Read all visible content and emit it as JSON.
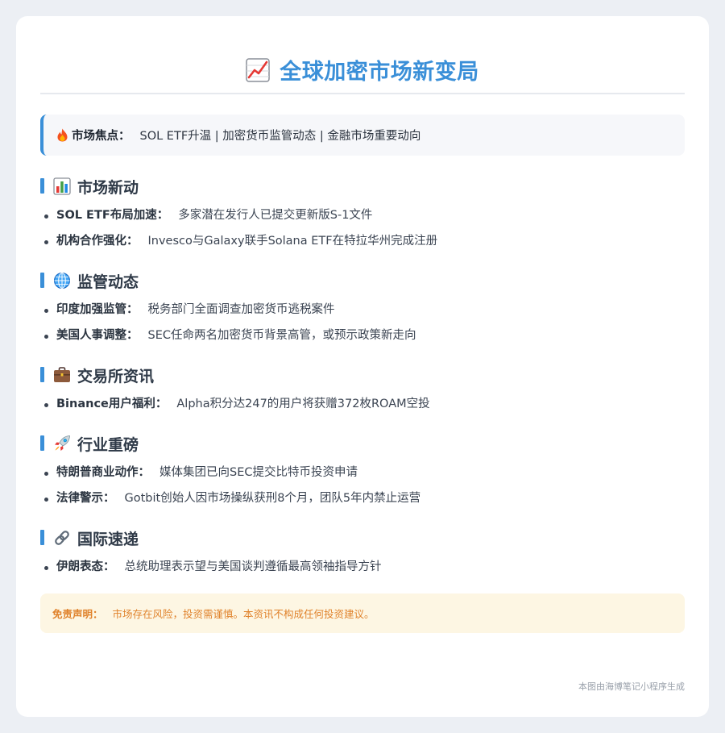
{
  "header": {
    "title": "全球加密市场新变局",
    "title_icon": "chart-increasing-icon"
  },
  "focus": {
    "icon": "fire-icon",
    "label": "市场焦点：",
    "text": "SOL ETF升温 | 加密货币监管动态 | 金融市场重要动向"
  },
  "sections": [
    {
      "title": "市场新动",
      "icon": "bar-chart-icon",
      "items": [
        {
          "label": "SOL ETF布局加速：",
          "text": "多家潜在发行人已提交更新版S-1文件"
        },
        {
          "label": "机构合作强化：",
          "text": "Invesco与Galaxy联手Solana ETF在特拉华州完成注册"
        }
      ]
    },
    {
      "title": "监管动态",
      "icon": "globe-icon",
      "items": [
        {
          "label": "印度加强监管：",
          "text": "税务部门全面调查加密货币逃税案件"
        },
        {
          "label": "美国人事调整：",
          "text": "SEC任命两名加密货币背景高管，或预示政策新走向"
        }
      ]
    },
    {
      "title": "交易所资讯",
      "icon": "briefcase-icon",
      "items": [
        {
          "label": "Binance用户福利：",
          "text": "Alpha积分达247的用户将获赠372枚ROAM空投"
        }
      ]
    },
    {
      "title": "行业重磅",
      "icon": "rocket-icon",
      "items": [
        {
          "label": "特朗普商业动作：",
          "text": "媒体集团已向SEC提交比特币投资申请"
        },
        {
          "label": "法律警示：",
          "text": "Gotbit创始人因市场操纵获刑8个月，团队5年内禁止运营"
        }
      ]
    },
    {
      "title": "国际速递",
      "icon": "link-icon",
      "items": [
        {
          "label": "伊朗表态：",
          "text": "总统助理表示望与美国谈判遵循最高领袖指导方针"
        }
      ]
    }
  ],
  "disclaimer": {
    "label": "免责声明：",
    "text": "市场存在风险，投资需谨慎。本资讯不构成任何投资建议。"
  },
  "footer": {
    "text": "本图由海博笔记小程序生成"
  },
  "colors": {
    "accent": "#3a8fd8",
    "disclaimer_text": "#e0822b",
    "disclaimer_bg": "#fdf6e3"
  }
}
